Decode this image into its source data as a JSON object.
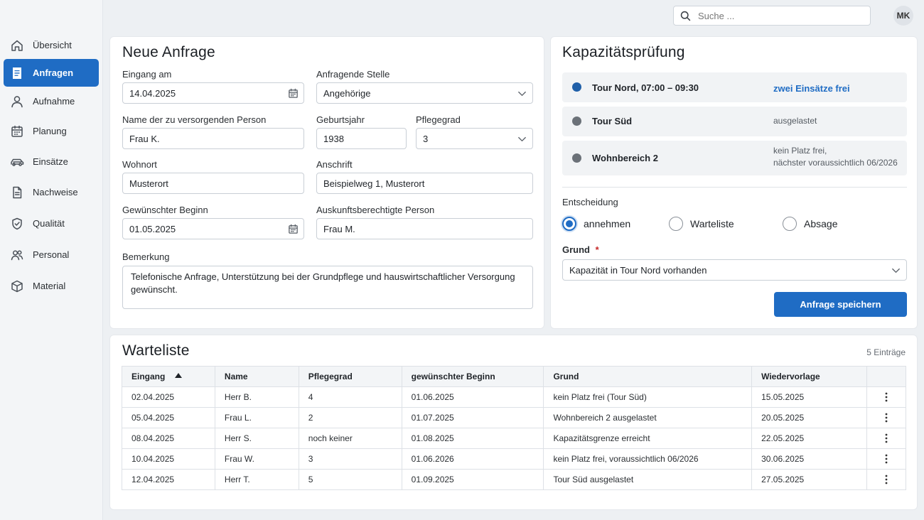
{
  "search": {
    "placeholder": "Suche ..."
  },
  "user": {
    "initials": "MK"
  },
  "sidebar": {
    "items": [
      {
        "label": "Übersicht",
        "icon": "home-icon",
        "active": false
      },
      {
        "label": "Anfragen",
        "icon": "document-icon",
        "active": true
      },
      {
        "label": "Aufnahme",
        "icon": "user-icon",
        "active": false
      },
      {
        "label": "Planung",
        "icon": "calendar-icon",
        "active": false
      },
      {
        "label": "Einsätze",
        "icon": "car-icon",
        "active": false
      },
      {
        "label": "Nachweise",
        "icon": "file-icon",
        "active": false
      },
      {
        "label": "Qualität",
        "icon": "shield-icon",
        "active": false
      },
      {
        "label": "Personal",
        "icon": "people-icon",
        "active": false
      },
      {
        "label": "Material",
        "icon": "box-icon",
        "active": false
      }
    ]
  },
  "form": {
    "title": "Neue Anfrage",
    "eingang_label": "Eingang am",
    "eingang_value": "14.04.2025",
    "stelle_label": "Anfragende Stelle",
    "stelle_value": "Angehörige",
    "name_label": "Name der zu versorgenden Person",
    "name_value": "Frau K.",
    "geburtsjahr_label": "Geburtsjahr",
    "geburtsjahr_value": "1938",
    "pflegegrad_label": "Pflegegrad",
    "pflegegrad_value": "3",
    "wohnort_label": "Wohnort",
    "wohnort_value": "Musterort",
    "anschrift_label": "Anschrift",
    "anschrift_value": "Beispielweg 1, Musterort",
    "beginn_label": "Gewünschter Beginn",
    "beginn_value": "01.05.2025",
    "auskunft_label": "Auskunftsberechtigte Person",
    "auskunft_value": "Frau M.",
    "bemerkung_label": "Bemerkung",
    "bemerkung_value": "Telefonische Anfrage, Unterstützung bei der Grundpflege und hauswirtschaftlicher Versorgung gewünscht."
  },
  "capacity": {
    "title": "Kapazitätsprüfung",
    "rows": [
      {
        "name": "Tour Nord, 07:00 – 09:30",
        "status": "zwei Einsätze frei",
        "dot_color": "#1f5fa8"
      },
      {
        "name": "Tour Süd",
        "status": "ausgelastet",
        "dot_color": "#6b7178"
      },
      {
        "name": "Wohnbereich 2",
        "status_line1": "kein Platz frei,",
        "status_line2": "nächster voraussichtlich 06/2026",
        "dot_color": "#6b7178"
      }
    ],
    "decision_label": "Entscheidung",
    "options": [
      "annehmen",
      "Warteliste",
      "Absage"
    ],
    "selected_option": "annehmen",
    "grund_label": "Grund",
    "grund_required": "*",
    "grund_value": "Kapazität in Tour Nord vorhanden",
    "save_label": "Anfrage speichern"
  },
  "waitlist": {
    "title": "Warteliste",
    "count": "5 Einträge",
    "columns": [
      "Eingang",
      "Name",
      "Pflegegrad",
      "gewünschter Beginn",
      "Grund",
      "Wiedervorlage"
    ],
    "rows": [
      [
        "02.04.2025",
        "Herr B.",
        "4",
        "01.06.2025",
        "kein Platz frei (Tour Süd)",
        "15.05.2025"
      ],
      [
        "05.04.2025",
        "Frau L.",
        "2",
        "01.07.2025",
        "Wohnbereich 2 ausgelastet",
        "20.05.2025"
      ],
      [
        "08.04.2025",
        "Herr S.",
        "noch keiner",
        "01.08.2025",
        "Kapazitätsgrenze erreicht",
        "22.05.2025"
      ],
      [
        "10.04.2025",
        "Frau W.",
        "3",
        "01.06.2026",
        "kein Platz frei, voraussichtlich 06/2026",
        "30.06.2025"
      ],
      [
        "12.04.2025",
        "Herr T.",
        "5",
        "01.09.2025",
        "Tour Süd ausgelastet",
        "27.05.2025"
      ]
    ]
  }
}
